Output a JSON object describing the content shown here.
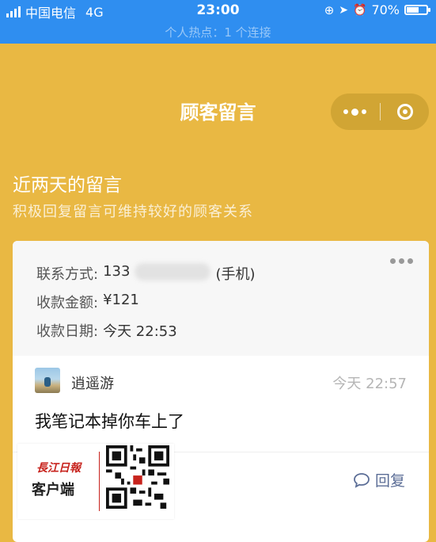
{
  "status_bar": {
    "carrier": "中国电信",
    "network": "4G",
    "time": "23:00",
    "battery": "70%",
    "battery_level": 0.7,
    "hotspot": "个人热点：1 个连接"
  },
  "nav": {
    "title": "顾客留言"
  },
  "section": {
    "title": "近两天的留言",
    "subtitle": "积极回复留言可维持较好的顾客关系"
  },
  "card": {
    "contact_label": "联系方式:",
    "contact_value": "133",
    "contact_suffix": "(手机)",
    "amount_label": "收款金额:",
    "amount_value": "¥121",
    "date_label": "收款日期:",
    "date_value": "今天 22:53",
    "message": {
      "user": "逍遥游",
      "time": "今天 22:57",
      "text": "我笔记本掉你车上了"
    },
    "reply_label": "回复"
  },
  "watermark": {
    "logo": "長江日報",
    "app": "客户端"
  }
}
